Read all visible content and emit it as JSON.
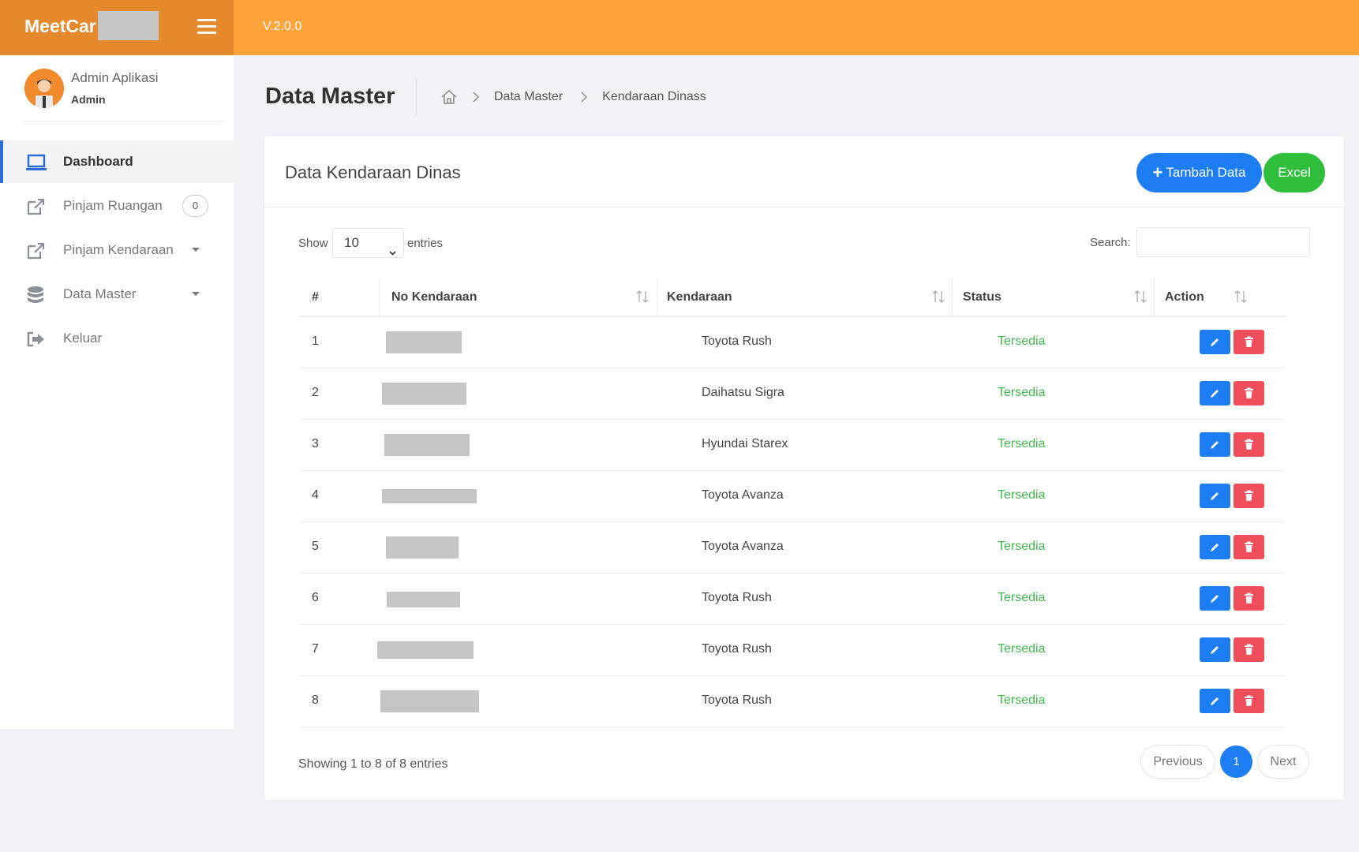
{
  "app": {
    "brand": "MeetCar",
    "version": "V.2.0.0"
  },
  "user": {
    "name": "Admin Aplikasi",
    "role": "Admin"
  },
  "sidebar": {
    "items": [
      {
        "label": "Dashboard",
        "icon": "laptop-icon",
        "active": true
      },
      {
        "label": "Pinjam Ruangan",
        "icon": "external-link-icon",
        "badge": "0"
      },
      {
        "label": "Pinjam Kendaraan",
        "icon": "external-link-icon",
        "dropdown": true
      },
      {
        "label": "Data Master",
        "icon": "database-icon",
        "dropdown": true
      },
      {
        "label": "Keluar",
        "icon": "sign-out-icon"
      }
    ]
  },
  "header": {
    "title": "Data Master",
    "breadcrumb": [
      "Data Master",
      "Kendaraan Dinass"
    ]
  },
  "card": {
    "title": "Data Kendaraan Dinas",
    "add_label": "Tambah Data",
    "excel_label": "Excel"
  },
  "table_controls": {
    "show_label": "Show",
    "page_size": "10",
    "entries_label": "entries",
    "search_label": "Search:",
    "search_value": ""
  },
  "table": {
    "columns": [
      "#",
      "No Kendaraan",
      "Kendaraan",
      "Status",
      "Action"
    ],
    "rows": [
      {
        "num": "1",
        "vehicle": "Toyota Rush",
        "status": "Tersedia"
      },
      {
        "num": "2",
        "vehicle": "Daihatsu Sigra",
        "status": "Tersedia"
      },
      {
        "num": "3",
        "vehicle": "Hyundai Starex",
        "status": "Tersedia"
      },
      {
        "num": "4",
        "vehicle": "Toyota Avanza",
        "status": "Tersedia"
      },
      {
        "num": "5",
        "vehicle": "Toyota Avanza",
        "status": "Tersedia"
      },
      {
        "num": "6",
        "vehicle": "Toyota Rush",
        "status": "Tersedia"
      },
      {
        "num": "7",
        "vehicle": "Toyota Rush",
        "status": "Tersedia"
      },
      {
        "num": "8",
        "vehicle": "Toyota Rush",
        "status": "Tersedia"
      }
    ]
  },
  "footer": {
    "info": "Showing 1 to 8 of 8 entries",
    "prev_label": "Previous",
    "current_page": "1",
    "next_label": "Next"
  },
  "colors": {
    "topbar": "#ffa43a",
    "brand_bg": "#e48a2d",
    "primary": "#1c7ef2",
    "success": "#2fbf3c",
    "danger": "#ef4e5a",
    "status_text": "#3dbb4a"
  }
}
